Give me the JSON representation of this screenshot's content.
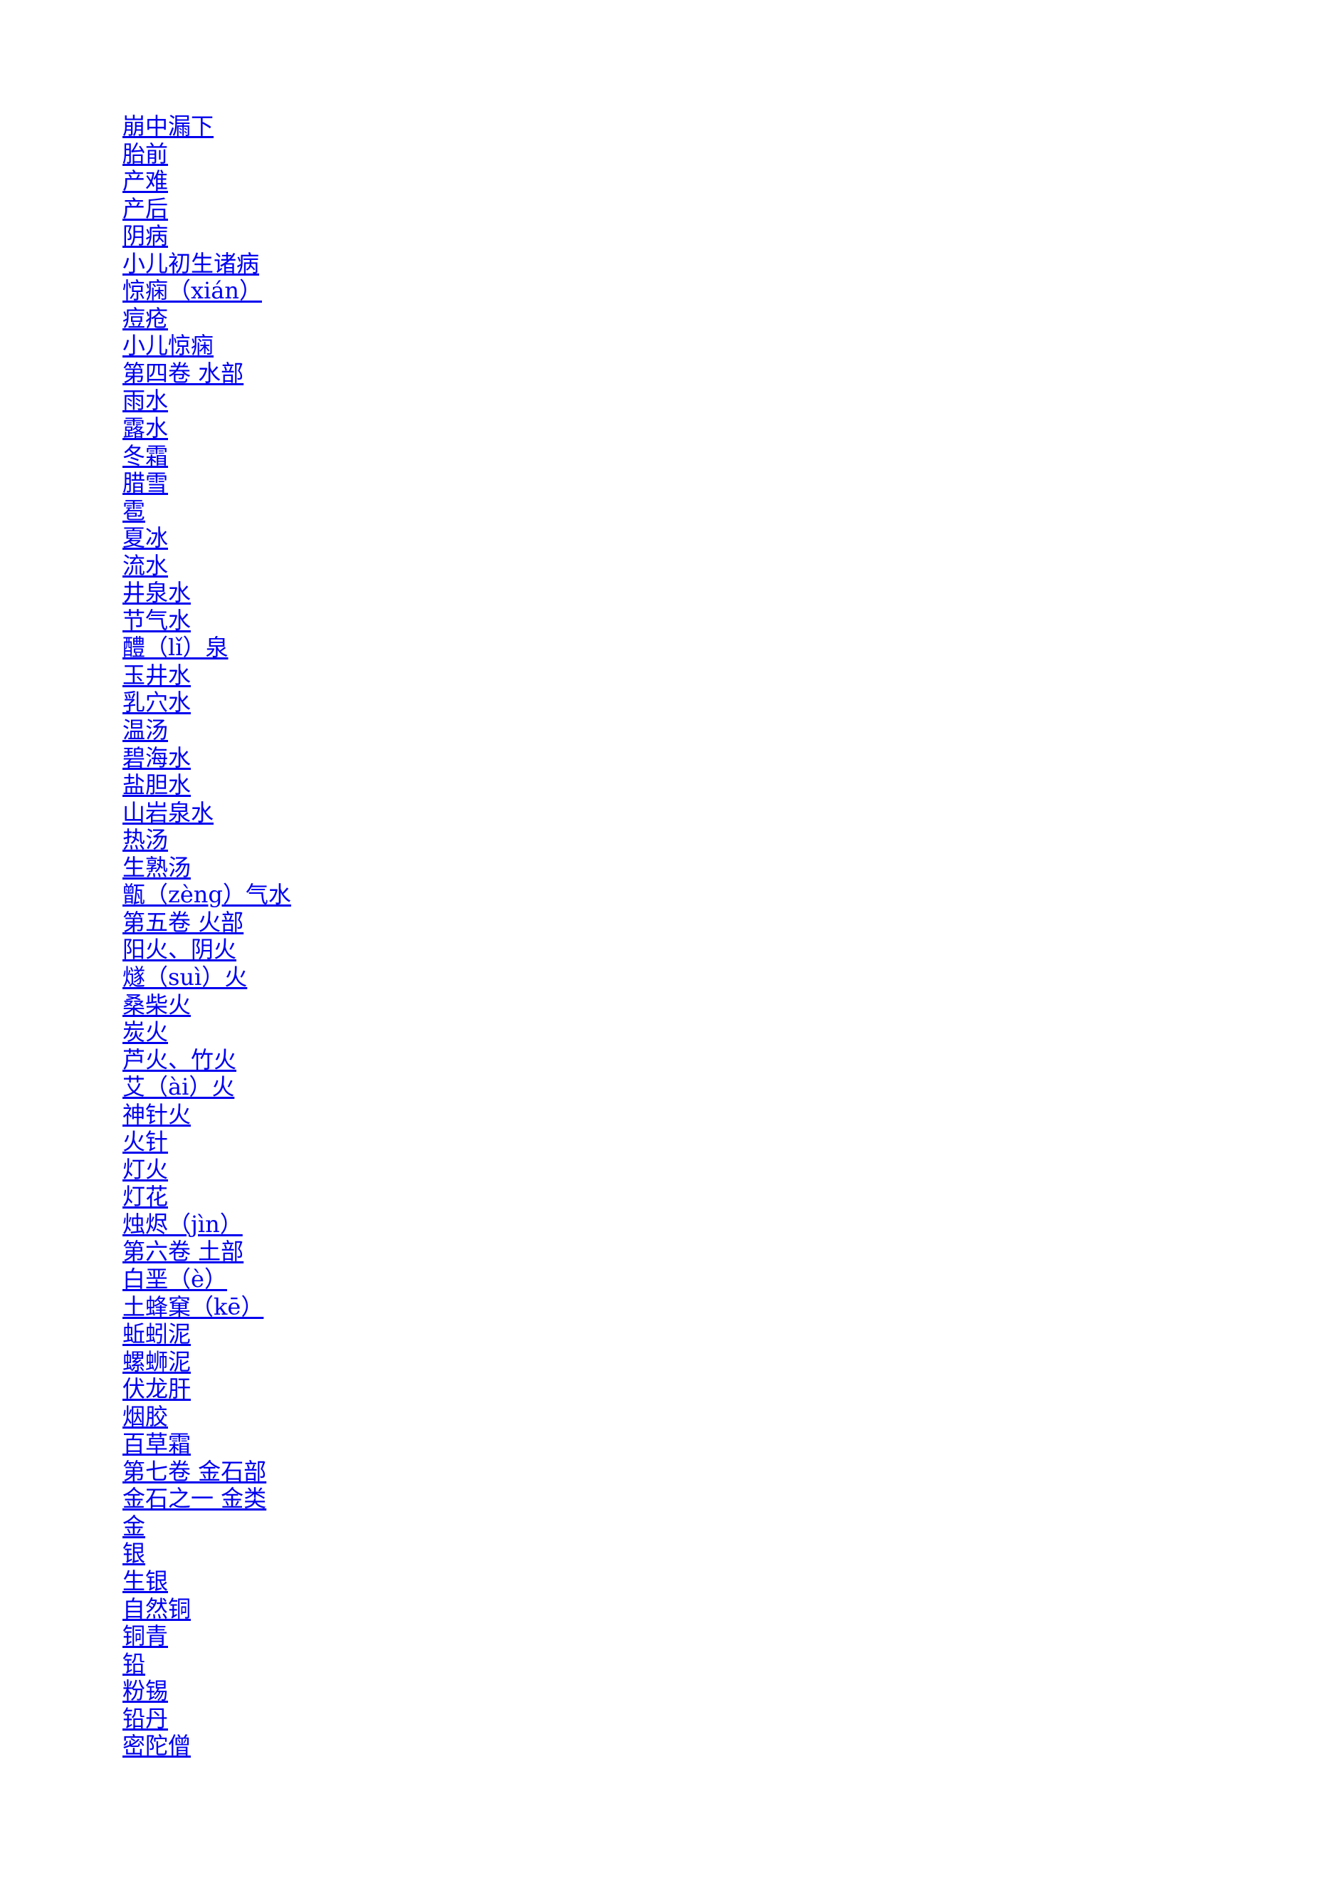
{
  "document": {
    "link_color": "#0000ee",
    "toc_links": [
      "崩中漏下",
      "胎前",
      "产难",
      "产后",
      "阴病",
      "小儿初生诸病",
      "惊痫（xián）",
      "痘疮",
      "小儿惊痫",
      "第四卷 水部",
      "雨水",
      "露水",
      "冬霜",
      "腊雪",
      "雹",
      "夏冰",
      "流水",
      "井泉水",
      "节气水",
      "醴（lǐ）泉",
      "玉井水",
      "乳穴水",
      "温汤",
      "碧海水",
      "盐胆水",
      "山岩泉水",
      "热汤",
      "生熟汤",
      "甑（zèng）气水",
      "第五卷 火部",
      "阳火、阴火",
      "燧（suì）火",
      "桑柴火",
      "炭火",
      "芦火、竹火",
      "艾（ài）火",
      "神针火",
      "火针",
      "灯火",
      "灯花",
      "烛烬（jìn）",
      "第六卷 土部",
      "白垩（è）",
      "土蜂窠（kē）",
      "蚯蚓泥",
      "螺蛳泥",
      "伏龙肝",
      "烟胶",
      "百草霜",
      "第七卷 金石部",
      "金石之一 金类",
      "金",
      "银",
      "生银",
      "自然铜",
      "铜青",
      "铅",
      "粉锡",
      "铅丹",
      "密陀僧"
    ]
  }
}
